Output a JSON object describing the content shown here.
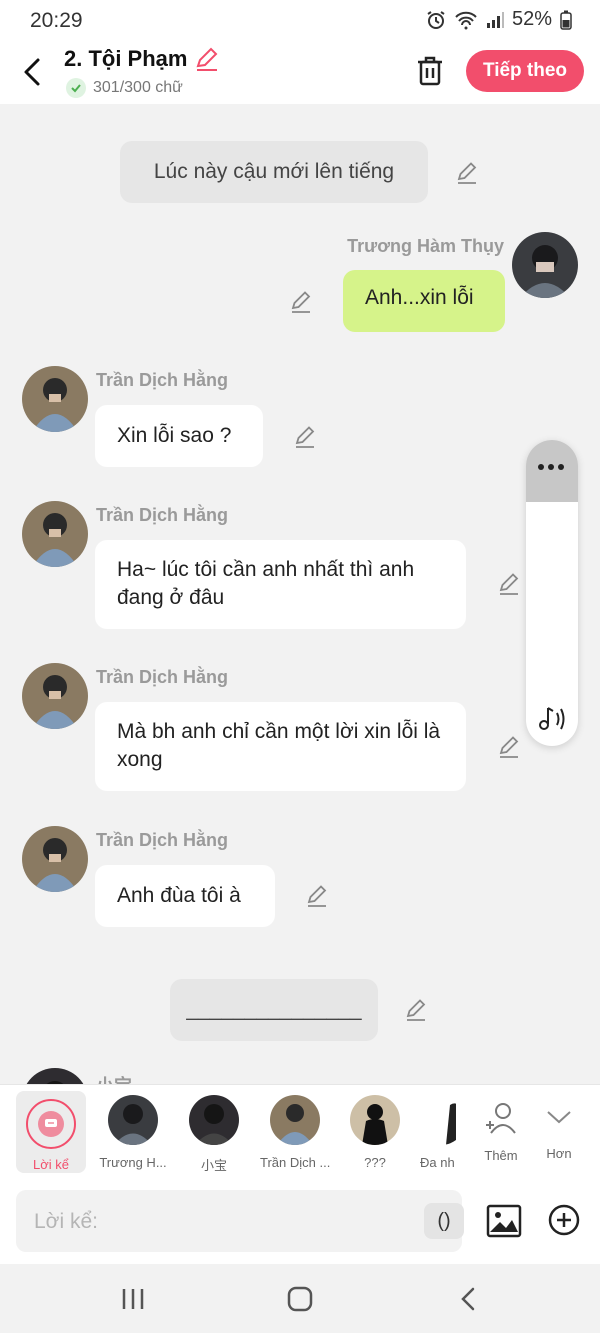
{
  "status": {
    "time": "20:29",
    "battery": "52%"
  },
  "header": {
    "title": "2. Tội Phạm",
    "char_count": "301/300 chữ",
    "next_button": "Tiếp theo"
  },
  "messages": {
    "narration_1": "Lúc này cậu mới lên tiếng",
    "me_name": "Trương Hàm Thụy",
    "me_text": "Anh...xin lỗi",
    "sender_1": "Trần Dịch Hằng",
    "text_1": "Xin lỗi sao ?",
    "sender_2": "Trần Dịch Hằng",
    "text_2": "Ha~ lúc tôi cần anh nhất thì anh đang ở đâu",
    "sender_3": "Trần Dịch Hằng",
    "text_3": "Mà bh anh chỉ cần một lời xin lỗi là xong",
    "sender_4": "Trần Dịch Hằng",
    "text_4": "Anh đùa tôi à",
    "narration_2": "_______________",
    "sender_5_partial": "小宝"
  },
  "characters": [
    {
      "label": "Lời kể"
    },
    {
      "label": "Trương H..."
    },
    {
      "label": "小宝"
    },
    {
      "label": "Trần Dịch ..."
    },
    {
      "label": "???"
    },
    {
      "label": "Đa nh"
    },
    {
      "label": "Thêm"
    },
    {
      "label": "Hơn"
    }
  ],
  "input": {
    "placeholder": "Lời kể:",
    "paren": "()"
  },
  "colors": {
    "accent": "#f24e6c",
    "my_bubble": "#d6f38a",
    "check": "#4caf50"
  }
}
